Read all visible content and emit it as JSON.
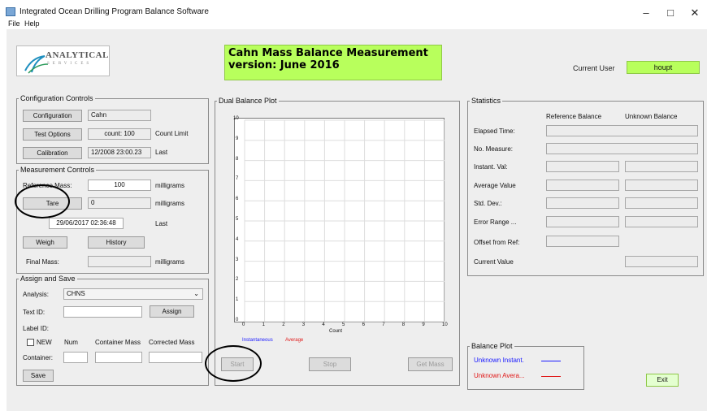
{
  "window": {
    "title": "Integrated Ocean Drilling Program Balance Software",
    "minimize": "–",
    "maximize": "□",
    "close": "✕"
  },
  "menu": {
    "file": "File",
    "help": "Help"
  },
  "logo": {
    "name": "ANALYTICAL",
    "sub": "SERVICES"
  },
  "banner": {
    "line1": "Cahn Mass Balance Measurement",
    "line2": "version: June 2016"
  },
  "user": {
    "label": "Current User",
    "value": "houpt"
  },
  "config": {
    "legend": "Configuration Controls",
    "configuration_btn": "Configuration",
    "configuration_value": "Cahn",
    "test_options_btn": "Test Options",
    "count_value": "count: 100",
    "count_label": "Count Limit",
    "calibration_btn": "Calibration",
    "calibration_value": "12/2008 23:00.23",
    "last_label": "Last"
  },
  "measurement": {
    "legend": "Measurement Controls",
    "reference_mass_label": "Reference Mass:",
    "reference_mass_value": "100",
    "milligrams1": "milligrams",
    "tare_btn": "Tare",
    "tare_value": "0",
    "milligrams2": "milligrams",
    "tare_date": "29/06/2017 02:36:48",
    "last_label": "Last",
    "weigh_btn": "Weigh",
    "history_btn": "History",
    "final_mass_label": "Final Mass:",
    "final_mass_value": "",
    "milligrams3": "milligrams"
  },
  "assign": {
    "legend": "Assign and Save",
    "analysis_label": "Analysis:",
    "analysis_value": "CHNS",
    "text_id_label": "Text ID:",
    "text_id_value": "",
    "assign_btn": "Assign",
    "label_id_label": "Label ID:",
    "new_label": "NEW",
    "num_label": "Num",
    "container_mass_label": "Container Mass",
    "corrected_mass_label": "Corrected Mass",
    "container_label": "Container:",
    "save_btn": "Save"
  },
  "plot": {
    "legend": "Dual Balance Plot",
    "y_ticks": [
      "10",
      "9",
      "8",
      "7",
      "6",
      "5",
      "4",
      "3",
      "2",
      "1",
      "0"
    ],
    "x_ticks": [
      "0",
      "1",
      "2",
      "3",
      "4",
      "5",
      "6",
      "7",
      "8",
      "9",
      "10"
    ],
    "xlabel": "Count",
    "legend_instant": "Instantaneous",
    "legend_average": "Average",
    "start_btn": "Start",
    "stop_btn": "Stop",
    "get_mass_btn": "Get Mass",
    "instant_color": "#1a1aff",
    "average_color": "#e01818"
  },
  "statistics": {
    "legend": "Statistics",
    "col_reference": "Reference Balance",
    "col_unknown": "Unknown Balance",
    "rows": [
      "Elapsed Time:",
      "No. Measure:",
      "Instant. Val:",
      "Average Value",
      "Std. Dev.:",
      "Error Range ...",
      "Offset from Ref:",
      "Current Value"
    ]
  },
  "balance_plot": {
    "legend": "Balance Plot",
    "unknown_instant": "Unknown Instant.",
    "unknown_average": "Unknown Avera...",
    "instant_color": "#1a1aff",
    "average_color": "#e01818"
  },
  "exit_btn": "Exit"
}
